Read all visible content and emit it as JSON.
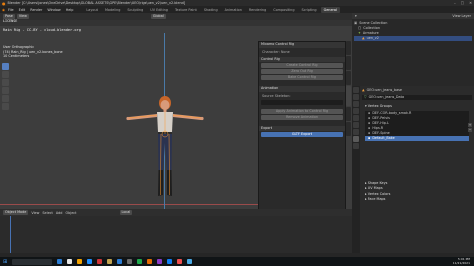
{
  "window": {
    "title": "Blender [C:\\Users\\jones\\OneDrive\\Desktop\\GLOBAL ASSETS\\GPE\\Blender\\UEO\\rigs\\uen_v2\\uen_v2.blend]",
    "controls": [
      "–",
      "□",
      "✕"
    ]
  },
  "menu": [
    "File",
    "Edit",
    "Render",
    "Window",
    "Help"
  ],
  "workspaces": [
    "Layout",
    "Modeling",
    "Sculpting",
    "UV Editing",
    "Texture Paint",
    "Shading",
    "Animation",
    "Rendering",
    "Compositing",
    "Scripting",
    "General"
  ],
  "active_workspace": "General",
  "viewport": {
    "mode": "Pose",
    "overlay_line1": "LICENSE",
    "overlay_line2": "Rain Rig - CC-BY - cloud.blender.org",
    "orientation": "Global",
    "view_name": "User Orthographic",
    "view_sub": "(74) Rain_Rig | uen_v2.bones_bone",
    "view_units": "10 Centimeters",
    "mode_dropdown": "Object Mode",
    "view_menu": [
      "View",
      "Select",
      "Add",
      "Object"
    ],
    "transform": "Local"
  },
  "npanel": {
    "header": "Mixamo Control Rig",
    "character_label": "Character: None",
    "control_rig_section": "Control Rig",
    "buttons": [
      "Create Control Rig",
      "Zero Out Rig",
      "Bake Control Rig"
    ],
    "animation_section": "Animation",
    "source_label": "Source Skeleton:",
    "apply_button": "Apply Animation to Control Rig",
    "remove_button": "Remove Animation",
    "export_section": "Export",
    "export_button": "GLTF Export",
    "tabs": [
      "Item",
      "Tool",
      "View",
      "Mixamo",
      "Edit",
      "Create"
    ]
  },
  "outliner": {
    "header": "View Layer",
    "rows": [
      {
        "label": "Scene Collection",
        "indent": 0
      },
      {
        "label": "Collection",
        "indent": 1
      },
      {
        "label": "Armature",
        "indent": 1
      },
      {
        "label": "uen_v2",
        "indent": 2
      }
    ]
  },
  "properties": {
    "object_name": "GEO:uen_jeans_base",
    "data_name": "GEO:uen_jeans_Data",
    "vertex_groups_label": "Vertex Groups",
    "vertex_groups": [
      "DEF-COR-body_smak.R",
      "DEF-Pelvis",
      "DEF-Hip.L",
      "Hips.R",
      "DEF-Spine",
      "Default_Bake"
    ],
    "selected_group_index": 5,
    "sections": [
      "Shape Keys",
      "UV Maps",
      "Vertex Colors",
      "Face Maps"
    ]
  },
  "taskbar": {
    "time": "5:01 PM",
    "date": "11/21/2021",
    "icon_colors": [
      "#2b7cd3",
      "#e8e8e8",
      "#f4a300",
      "#1e90ff",
      "#d13438",
      "#c3a34f",
      "#2b7cd3",
      "#6c6c6c",
      "#1ea94c",
      "#e66b00",
      "#8c3ac6",
      "#0f7ef4",
      "#f04e4e",
      "#48a9e6"
    ]
  },
  "accent_color": "#4772b3"
}
